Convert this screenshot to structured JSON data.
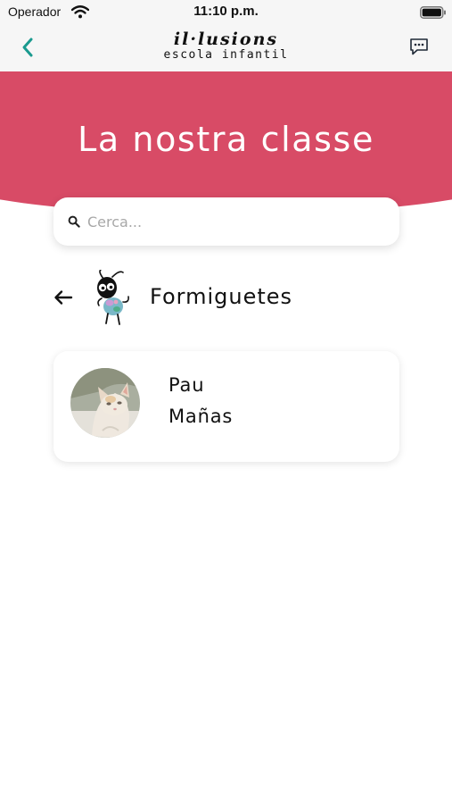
{
  "status_bar": {
    "carrier": "Operador",
    "time": "11:10 p.m."
  },
  "nav": {
    "back_icon": "chevron-left-icon",
    "logo_script": "il·lusions",
    "logo_subtitle": "escola infantil",
    "chat_icon": "chat-bubble-icon"
  },
  "header": {
    "title": "La nostra classe"
  },
  "search": {
    "placeholder": "Cerca...",
    "value": "",
    "icon": "search-icon"
  },
  "class_group": {
    "name": "Formiguetes",
    "back_icon": "arrow-left-icon"
  },
  "students": [
    {
      "first_name": "Pau",
      "last_name": "Mañas"
    }
  ],
  "colors": {
    "accent": "#d84b66",
    "nav_icon": "#1a9a8f",
    "status_bar_bg": "#f6f6f6",
    "text": "#111111",
    "placeholder": "#a8a8a8"
  }
}
